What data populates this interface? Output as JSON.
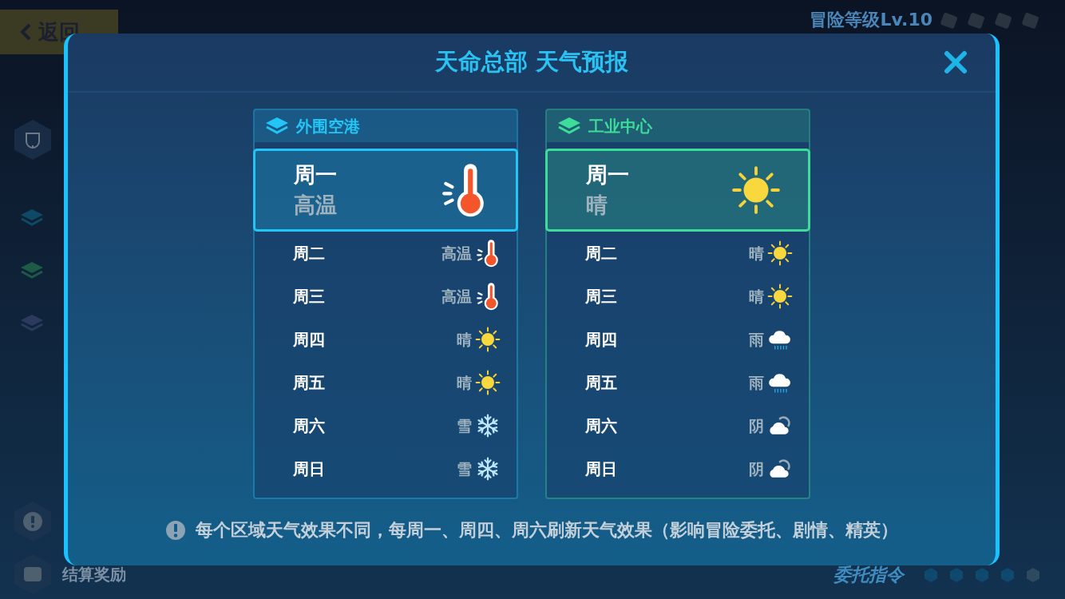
{
  "back_button": "返回",
  "adventure_level": "冒险等级Lv.10",
  "bottom_left": "结算奖励",
  "bottom_right": "委托指令",
  "dialog": {
    "title": "天命总部 天气预报",
    "regions": [
      {
        "name": "外围空港",
        "color": "#22c5f5",
        "days": [
          {
            "day": "周一",
            "weather": "高温",
            "kind": "hot",
            "selected": true
          },
          {
            "day": "周二",
            "weather": "高温",
            "kind": "hot",
            "selected": false
          },
          {
            "day": "周三",
            "weather": "高温",
            "kind": "hot",
            "selected": false
          },
          {
            "day": "周四",
            "weather": "晴",
            "kind": "sunny",
            "selected": false
          },
          {
            "day": "周五",
            "weather": "晴",
            "kind": "sunny",
            "selected": false
          },
          {
            "day": "周六",
            "weather": "雪",
            "kind": "snow",
            "selected": false
          },
          {
            "day": "周日",
            "weather": "雪",
            "kind": "snow",
            "selected": false
          }
        ]
      },
      {
        "name": "工业中心",
        "color": "#3ddc9a",
        "days": [
          {
            "day": "周一",
            "weather": "晴",
            "kind": "sunny",
            "selected": true
          },
          {
            "day": "周二",
            "weather": "晴",
            "kind": "sunny",
            "selected": false
          },
          {
            "day": "周三",
            "weather": "晴",
            "kind": "sunny",
            "selected": false
          },
          {
            "day": "周四",
            "weather": "雨",
            "kind": "rain",
            "selected": false
          },
          {
            "day": "周五",
            "weather": "雨",
            "kind": "rain",
            "selected": false
          },
          {
            "day": "周六",
            "weather": "阴",
            "kind": "cloudy",
            "selected": false
          },
          {
            "day": "周日",
            "weather": "阴",
            "kind": "cloudy",
            "selected": false
          }
        ]
      }
    ],
    "notice": "每个区域天气效果不同，每周一、周四、周六刷新天气效果（影响冒险委托、剧情、精英）"
  }
}
